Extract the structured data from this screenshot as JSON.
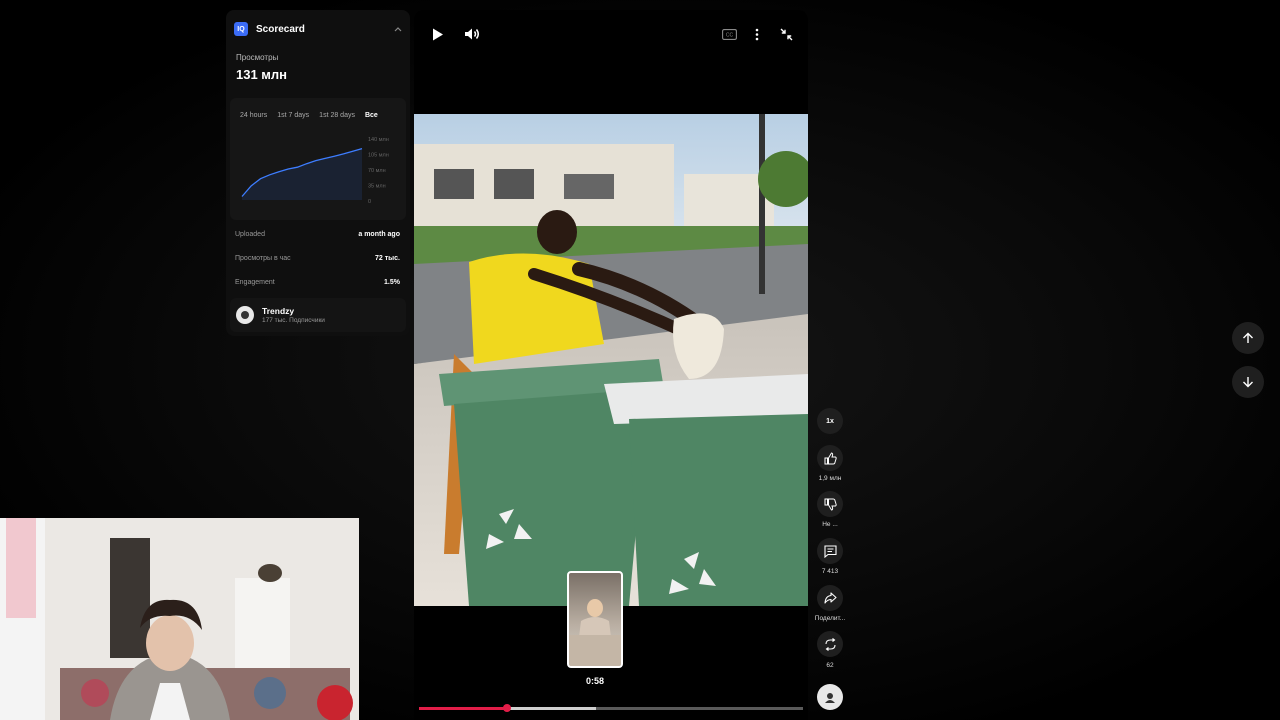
{
  "scorecard": {
    "title": "Scorecard",
    "logo_text": "IQ",
    "views_label": "Просмотры",
    "views_value": "131 млн",
    "tabs": [
      "24 hours",
      "1st 7 days",
      "1st 28 days",
      "Все"
    ],
    "active_tab": "Все",
    "chart_data": {
      "type": "area",
      "title": "",
      "xlabel": "",
      "ylabel": "",
      "y_tick_labels": [
        "140 млн",
        "105 млн",
        "70 млн",
        "35 млн",
        "0"
      ],
      "ylim": [
        0,
        140
      ],
      "x": [
        0,
        1,
        2,
        3,
        4,
        5,
        6,
        7,
        8,
        9,
        10,
        11,
        12,
        13
      ],
      "values": [
        8,
        32,
        48,
        57,
        64,
        70,
        74,
        82,
        89,
        94,
        99,
        104,
        110,
        116
      ],
      "accent": "#3d7dff"
    },
    "stats": [
      {
        "label": "Uploaded",
        "value": "a month ago"
      },
      {
        "label": "Просмотры в час",
        "value": "72 тыс."
      },
      {
        "label": "Engagement",
        "value": "1.5%"
      }
    ],
    "channel": {
      "name": "Trendzy",
      "subscribers": "177 тыс. Подписчики"
    }
  },
  "player": {
    "preview_time": "0:58",
    "progress_played": 0.23,
    "progress_preview": 0.46
  },
  "rail": {
    "speed": "1x",
    "like_count": "1,9 млн",
    "dislike_label": "Не ...",
    "comments_count": "7 413",
    "share_label": "Поделит...",
    "remix_count": "62"
  },
  "colors": {
    "accent_red": "#e21d48",
    "panel_bg": "#0f0f0f",
    "accent_blue": "#3b6cf6"
  }
}
